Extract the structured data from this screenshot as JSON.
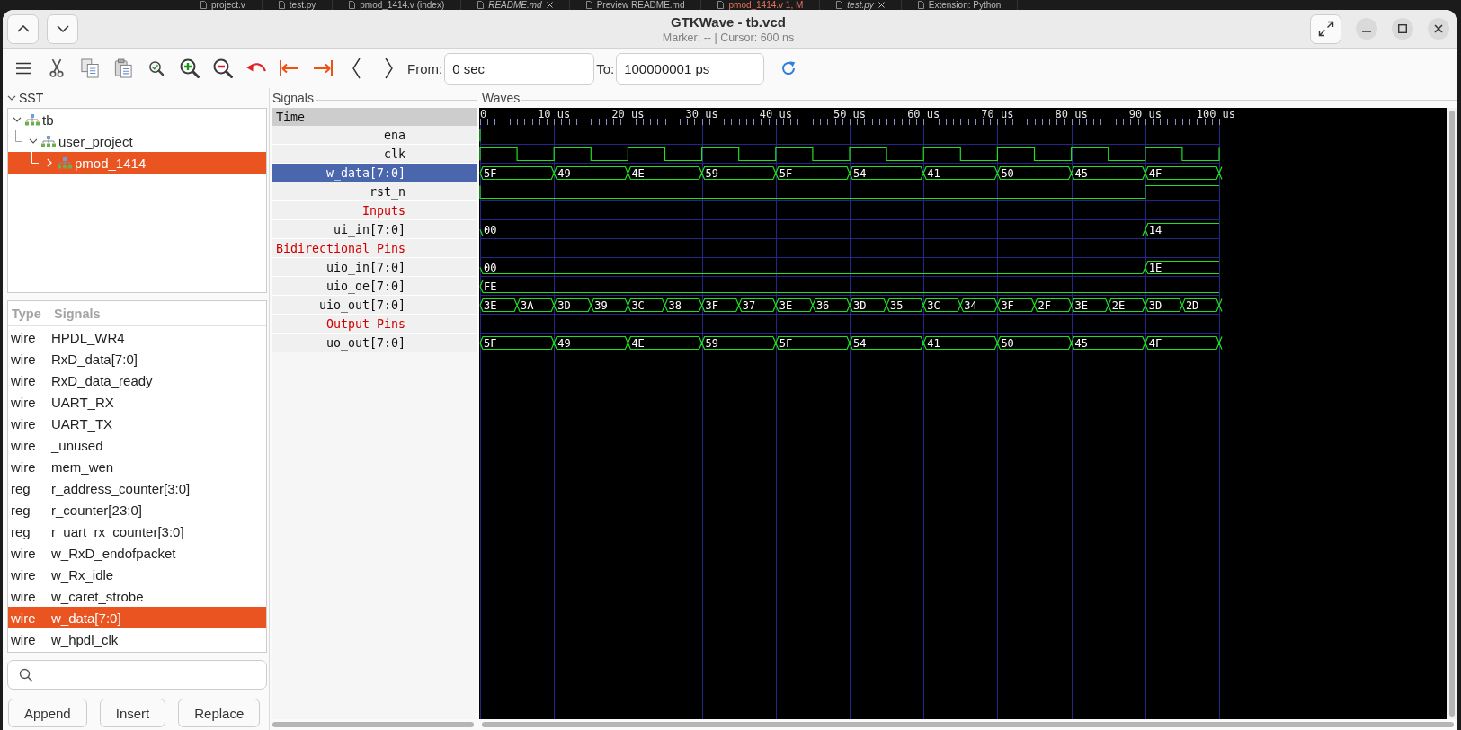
{
  "background_tabs": [
    {
      "label": "project.v",
      "kind": "plain",
      "closable": false
    },
    {
      "label": "test.py",
      "kind": "plain",
      "closable": false
    },
    {
      "label": "pmod_1414.v (index)",
      "kind": "plain",
      "closable": false
    },
    {
      "label": "README.md",
      "kind": "preview",
      "closable": true
    },
    {
      "label": "Preview README.md",
      "kind": "plain",
      "closable": false
    },
    {
      "label": "pmod_1414.v 1, M",
      "kind": "error",
      "closable": false
    },
    {
      "label": "test.py",
      "kind": "preview",
      "closable": true
    },
    {
      "label": "Extension: Python",
      "kind": "plain",
      "closable": false
    }
  ],
  "window": {
    "title": "GTKWave - tb.vcd",
    "subtitle": "Marker: -- | Cursor: 600 ns"
  },
  "toolbar": {
    "from_label": "From:",
    "from_value": "0 sec",
    "to_label": "To:",
    "to_value": "100000001 ps"
  },
  "sst": {
    "title": "SST",
    "expanded": true,
    "tree": [
      {
        "label": "tb",
        "expanded": true,
        "selected": false,
        "children": [
          {
            "label": "user_project",
            "expanded": true,
            "selected": false,
            "children": [
              {
                "label": "pmod_1414",
                "expanded": false,
                "selected": true
              }
            ]
          }
        ]
      }
    ],
    "signals_table": {
      "columns": [
        "Type",
        "Signals"
      ],
      "rows": [
        {
          "type": "wire",
          "name": "HPDL_WR4",
          "selected": false
        },
        {
          "type": "wire",
          "name": "RxD_data[7:0]",
          "selected": false
        },
        {
          "type": "wire",
          "name": "RxD_data_ready",
          "selected": false
        },
        {
          "type": "wire",
          "name": "UART_RX",
          "selected": false
        },
        {
          "type": "wire",
          "name": "UART_TX",
          "selected": false
        },
        {
          "type": "wire",
          "name": "_unused",
          "selected": false
        },
        {
          "type": "wire",
          "name": "mem_wen",
          "selected": false
        },
        {
          "type": "reg",
          "name": "r_address_counter[3:0]",
          "selected": false
        },
        {
          "type": "reg",
          "name": "r_counter[23:0]",
          "selected": false
        },
        {
          "type": "reg",
          "name": "r_uart_rx_counter[3:0]",
          "selected": false
        },
        {
          "type": "wire",
          "name": "w_RxD_endofpacket",
          "selected": false
        },
        {
          "type": "wire",
          "name": "w_Rx_idle",
          "selected": false
        },
        {
          "type": "wire",
          "name": "w_caret_strobe",
          "selected": false
        },
        {
          "type": "wire",
          "name": "w_data[7:0]",
          "selected": true
        },
        {
          "type": "wire",
          "name": "w_hpdl_clk",
          "selected": false
        }
      ]
    },
    "buttons": [
      "Append",
      "Insert",
      "Replace"
    ]
  },
  "signals_pane": {
    "title": "Signals",
    "header": "Time",
    "rows": [
      {
        "kind": "signal",
        "name": "ena",
        "selected": false,
        "wave": {
          "kind": "constant_high"
        }
      },
      {
        "kind": "signal",
        "name": "clk",
        "selected": false,
        "wave": {
          "kind": "clock"
        }
      },
      {
        "kind": "signal",
        "name": "w_data[7:0]",
        "selected": true,
        "wave": {
          "kind": "bus",
          "continues": true,
          "values": [
            "5F",
            "49",
            "4E",
            "59",
            "5F",
            "54",
            "41",
            "50",
            "45",
            "4F"
          ]
        }
      },
      {
        "kind": "signal",
        "name": "rst_n",
        "selected": false,
        "wave": {
          "kind": "rise_at_end"
        }
      },
      {
        "kind": "comment",
        "name": "Inputs",
        "selected": false
      },
      {
        "kind": "signal",
        "name": "ui_in[7:0]",
        "selected": false,
        "wave": {
          "kind": "bus_change_at_end",
          "continues": false,
          "values": [
            "00",
            "14"
          ]
        }
      },
      {
        "kind": "comment",
        "name": "Bidirectional Pins",
        "selected": false
      },
      {
        "kind": "signal",
        "name": "uio_in[7:0]",
        "selected": false,
        "wave": {
          "kind": "bus_change_at_end",
          "continues": false,
          "values": [
            "00",
            "1E"
          ]
        }
      },
      {
        "kind": "signal",
        "name": "uio_oe[7:0]",
        "selected": false,
        "wave": {
          "kind": "bus",
          "continues": false,
          "values": [
            "FE"
          ]
        }
      },
      {
        "kind": "signal",
        "name": "uio_out[7:0]",
        "selected": false,
        "wave": {
          "kind": "bus",
          "continues": true,
          "values": [
            "3E",
            "3A",
            "3D",
            "39",
            "3C",
            "38",
            "3F",
            "37",
            "3E",
            "36",
            "3D",
            "35",
            "3C",
            "34",
            "3F",
            "2F",
            "3E",
            "2E",
            "3D",
            "2D"
          ]
        }
      },
      {
        "kind": "comment",
        "name": "Output Pins",
        "selected": false
      },
      {
        "kind": "signal",
        "name": "uo_out[7:0]",
        "selected": false,
        "wave": {
          "kind": "bus",
          "continues": true,
          "values": [
            "5F",
            "49",
            "4E",
            "59",
            "5F",
            "54",
            "41",
            "50",
            "45",
            "4F"
          ]
        }
      }
    ]
  },
  "waves_pane": {
    "title": "Waves",
    "time_ticks": [
      "0",
      "10 us",
      "20 us",
      "30 us",
      "40 us",
      "50 us",
      "60 us",
      "70 us",
      "80 us",
      "90 us",
      "100 us"
    ]
  }
}
